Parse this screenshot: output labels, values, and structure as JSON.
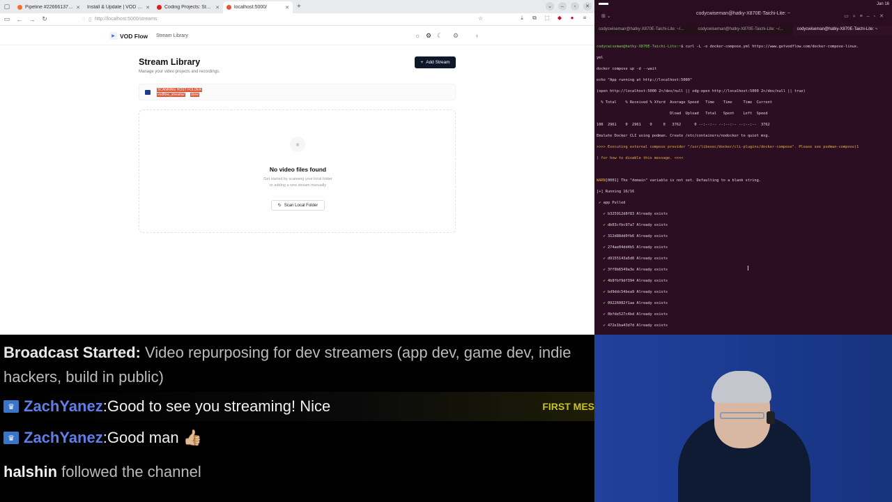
{
  "browser": {
    "tabs": [
      {
        "title": "Pipeline #2266613707 · c",
        "fav": "#fc6d26"
      },
      {
        "title": "Install & Update | VOD Flow · r",
        "fav": "#3b6ed8"
      },
      {
        "title": "Coding Projects: Stream",
        "fav": "#e21b1b"
      },
      {
        "title": "localhost:5000/",
        "fav": "#e05536"
      }
    ],
    "url": "http://localhost:5000/streams"
  },
  "app": {
    "logo": "VOD Flow",
    "nav_stream_library": "Stream Library",
    "page_title": "Stream Library",
    "page_subtitle": "Manage your video projects and recordings.",
    "add_stream_label": "Add Stream",
    "scan_status_line1": "Scanning host folder",
    "scan_status_line2": "vodflow_streams/",
    "scan_status_tag": "done",
    "empty_title": "No video files found",
    "empty_sub1": "Get started by scanning your local folder",
    "empty_sub2": "or adding a new stream manually",
    "scan_button_label": "Scan Local Folder"
  },
  "terminal": {
    "window_title": "codycwiseman@hatky-X870E-Taichi-Lite: ~",
    "tabs": [
      "codycwiseman@hatky-X870E-Taichi-Lite: ~/...",
      "codycwiseman@hatky-X870E-Taichi-Lite: ~/...",
      "codycwiseman@hatky-X870E-Taichi-Lite: ~"
    ],
    "clock": "Jan 16"
  },
  "chat": {
    "broadcast_label": "Broadcast Started:",
    "broadcast_text": "Video repurposing for dev streamers (app dev, game dev, indie hackers, build in public)",
    "messages": [
      {
        "user": "ZachYanez",
        "sep": ":",
        "text": "Good to see you streaming! Nice"
      },
      {
        "user": "ZachYanez",
        "sep": ":",
        "text": "Good man 👍🏼"
      }
    ],
    "first_msg_badge": "FIRST MES",
    "follow_user": "halshin",
    "follow_text": "followed the channel"
  }
}
